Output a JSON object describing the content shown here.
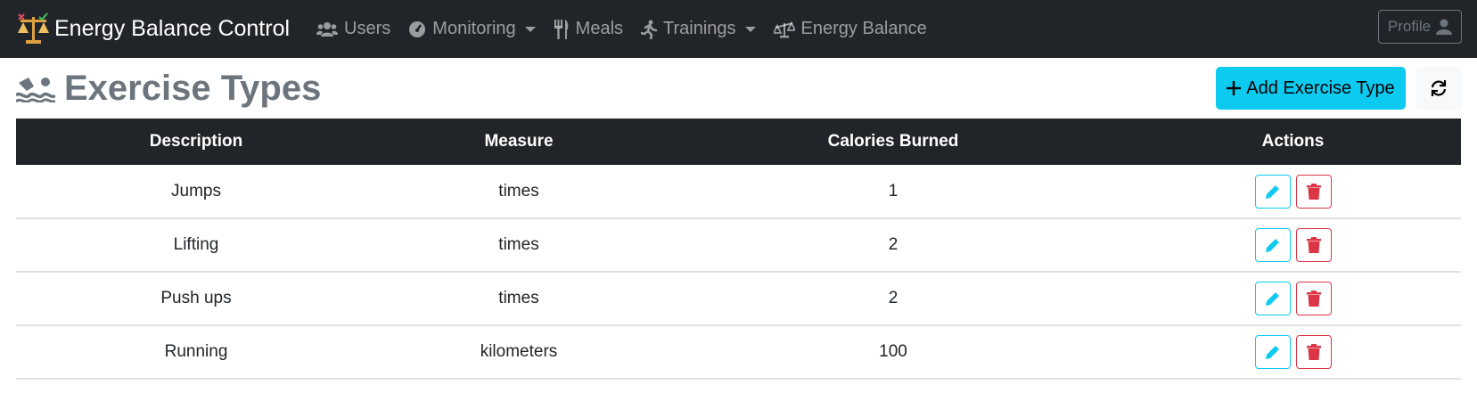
{
  "navbar": {
    "brand": "Energy Balance Control",
    "items": [
      {
        "label": "Users",
        "icon": "users-icon"
      },
      {
        "label": "Monitoring",
        "icon": "gauge-icon",
        "dropdown": true
      },
      {
        "label": "Meals",
        "icon": "utensils-icon"
      },
      {
        "label": "Trainings",
        "icon": "running-icon",
        "dropdown": true
      },
      {
        "label": "Energy Balance",
        "icon": "scale-icon"
      }
    ],
    "profile_label": "Profile"
  },
  "page": {
    "title": "Exercise Types",
    "add_label": "Add Exercise Type"
  },
  "table": {
    "headers": [
      "Description",
      "Measure",
      "Calories Burned",
      "Actions"
    ],
    "rows": [
      {
        "description": "Jumps",
        "measure": "times",
        "calories": "1"
      },
      {
        "description": "Lifting",
        "measure": "times",
        "calories": "2"
      },
      {
        "description": "Push ups",
        "measure": "times",
        "calories": "2"
      },
      {
        "description": "Running",
        "measure": "kilometers",
        "calories": "100"
      }
    ]
  },
  "colors": {
    "navbar": "#212529",
    "accent": "#0dcaf0",
    "danger": "#dc3545",
    "muted": "#6c757d"
  }
}
